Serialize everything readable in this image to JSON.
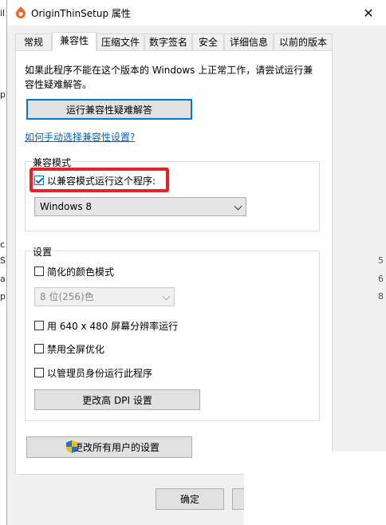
{
  "window": {
    "title": "OriginThinSetup 属性",
    "close_glyph": "✕"
  },
  "tabs": [
    {
      "label": "常规"
    },
    {
      "label": "兼容性"
    },
    {
      "label": "压缩文件"
    },
    {
      "label": "数字签名"
    },
    {
      "label": "安全"
    },
    {
      "label": "详细信息"
    },
    {
      "label": "以前的版本"
    }
  ],
  "active_tab": "兼容性",
  "intro_text": "如果此程序不能在这个版本的 Windows 上正常工作，请尝试运行兼容性疑难解答。",
  "troubleshoot_button": "运行兼容性疑难解答",
  "manual_link": "如何手动选择兼容性设置?",
  "compat_group": {
    "title": "兼容模式",
    "checkbox_label": "以兼容模式运行这个程序:",
    "checked": true,
    "os_value": "Windows 8"
  },
  "settings_group": {
    "title": "设置",
    "reduced_color_label": "简化的颜色模式",
    "color_value": "8 位(256)色",
    "res_label": "用 640 x 480 屏幕分辨率运行",
    "fullscreen_label": "禁用全屏优化",
    "admin_label": "以管理员身份运行此程序",
    "dpi_button": "更改高 DPI 设置"
  },
  "all_users_button": "更改所有用户的设置",
  "ok_button": "确定",
  "background_fragments": {
    "left": [
      "il",
      "p",
      "c",
      "S",
      "a",
      "p"
    ],
    "right": [
      "5",
      "6",
      "8"
    ]
  },
  "colors": {
    "accent": "#0078d7",
    "link": "#0066cc",
    "highlight": "#e8202a",
    "app_icon": "#f26722"
  },
  "icons": {
    "app": "origin-logo-icon",
    "close": "close-icon",
    "shield": "uac-shield-icon",
    "chevron": "chevron-down-icon"
  }
}
